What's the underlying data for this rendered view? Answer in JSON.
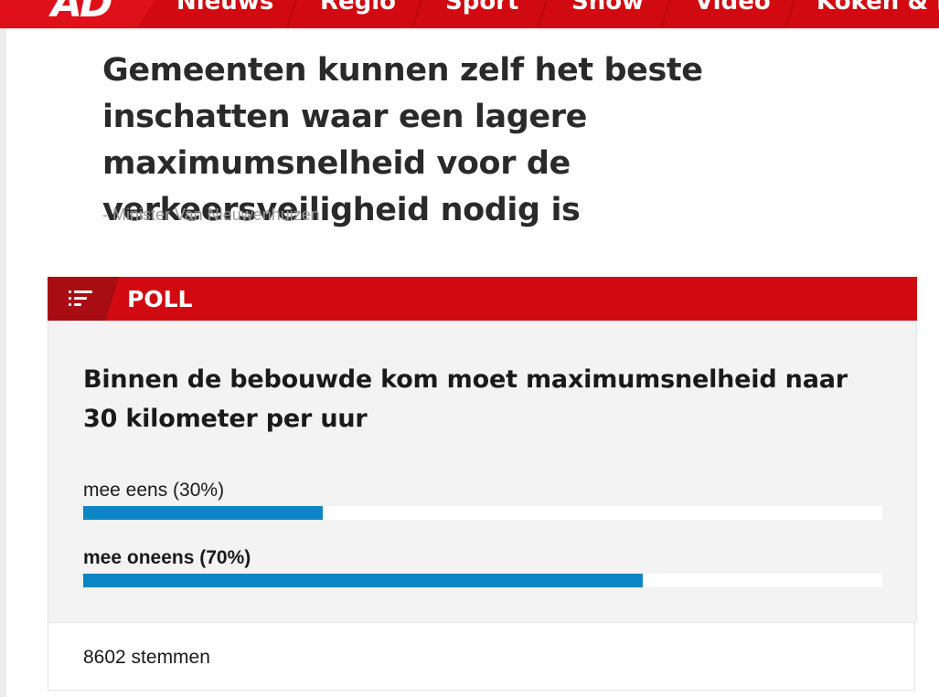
{
  "nav": {
    "logo": "AD",
    "items": [
      "Nieuws",
      "Regio",
      "Sport",
      "Show",
      "Video",
      "Koken & E"
    ]
  },
  "quote": {
    "text": "Gemeenten kunnen zelf het beste inschatten waar een lagere maximumsnelheid voor de verkeersveiligheid nodig is",
    "attribution": "- Minister Van Nieuwenhuizen"
  },
  "poll": {
    "header": "POLL",
    "icon": "poll-list-icon",
    "question": "Binnen de bebouwde kom moet maximumsnelheid naar 30 kilometer per uur",
    "options": [
      {
        "label": "mee eens (30%)",
        "percent": 30,
        "selected": false
      },
      {
        "label": "mee oneens (70%)",
        "percent": 70,
        "selected": true
      }
    ],
    "votes": "8602 stemmen"
  },
  "colors": {
    "brand_red": "#d10a11",
    "bar_blue": "#0d86c6"
  }
}
